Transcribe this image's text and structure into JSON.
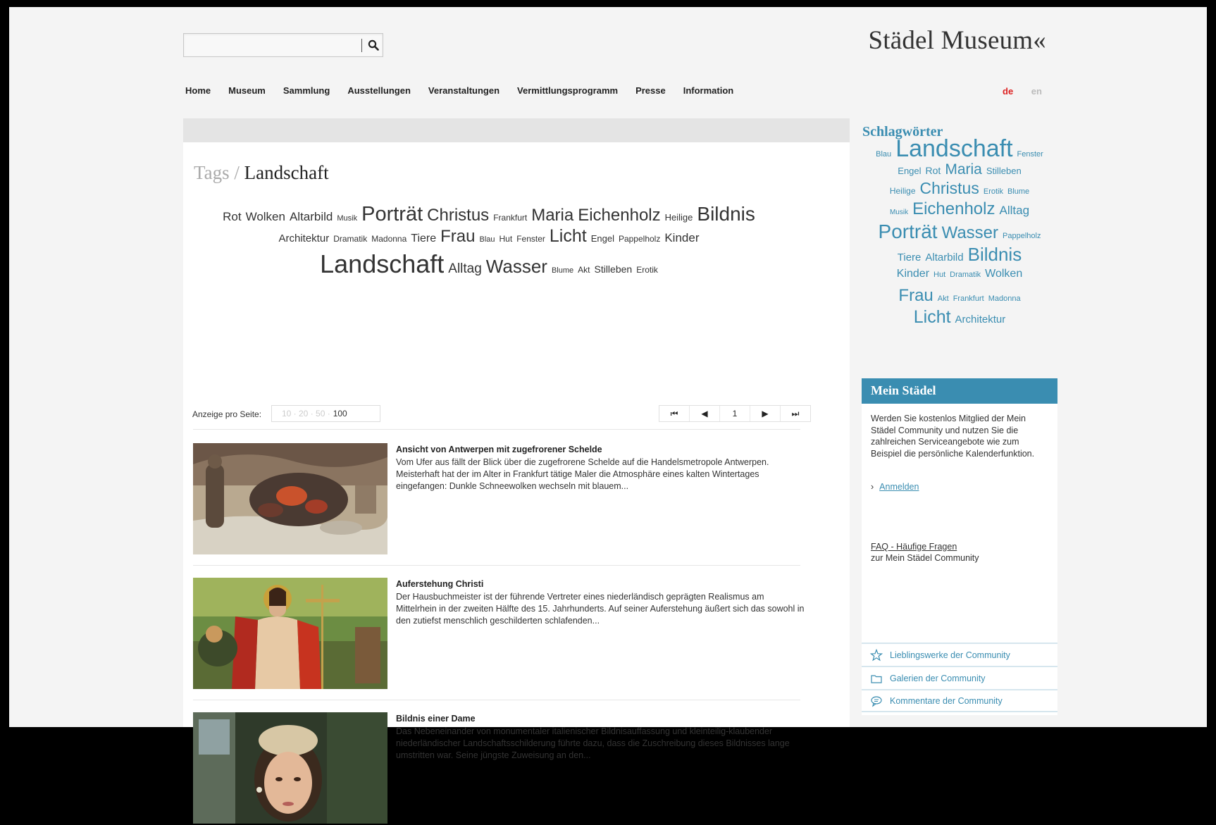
{
  "header": {
    "search_placeholder": "",
    "logo": "Städel Museum«"
  },
  "nav": [
    "Home",
    "Museum",
    "Sammlung",
    "Ausstellungen",
    "Veranstaltungen",
    "Vermittlungsprogramm",
    "Presse",
    "Information"
  ],
  "lang": {
    "de": "de",
    "en": "en"
  },
  "breadcrumb": {
    "tags": "Tags",
    "sep": " / ",
    "current": "Landschaft"
  },
  "tag_cloud": [
    [
      {
        "t": "Rot",
        "s": 17
      },
      {
        "t": "Wolken",
        "s": 17
      },
      {
        "t": "Altarbild",
        "s": 17
      },
      {
        "t": "Musik",
        "s": 11
      },
      {
        "t": "Porträt",
        "s": 29
      },
      {
        "t": "Christus",
        "s": 24
      },
      {
        "t": "Frankfurt",
        "s": 12
      },
      {
        "t": "Maria",
        "s": 24
      },
      {
        "t": "Eichenholz",
        "s": 24
      },
      {
        "t": "Heilige",
        "s": 13
      },
      {
        "t": "Bildnis",
        "s": 28
      }
    ],
    [
      {
        "t": "Architektur",
        "s": 15
      },
      {
        "t": "Dramatik",
        "s": 12
      },
      {
        "t": "Madonna",
        "s": 12
      },
      {
        "t": "Tiere",
        "s": 16
      },
      {
        "t": "Frau",
        "s": 24
      },
      {
        "t": "Blau",
        "s": 11
      },
      {
        "t": "Hut",
        "s": 12
      },
      {
        "t": "Fenster",
        "s": 12
      },
      {
        "t": "Licht",
        "s": 25
      },
      {
        "t": "Engel",
        "s": 13
      },
      {
        "t": "Pappelholz",
        "s": 12
      },
      {
        "t": "Kinder",
        "s": 17
      }
    ],
    [
      {
        "t": "Landschaft",
        "s": 36
      },
      {
        "t": "Alltag",
        "s": 19
      },
      {
        "t": "Wasser",
        "s": 26
      },
      {
        "t": "Blume",
        "s": 11
      },
      {
        "t": "Akt",
        "s": 12
      },
      {
        "t": "Stilleben",
        "s": 14
      },
      {
        "t": "Erotik",
        "s": 12
      }
    ]
  ],
  "pager": {
    "label": "Anzeige pro Seite:",
    "options_dim": "10 · 20 · 50 ·",
    "selected": "100",
    "first": "⏮",
    "prev": "◀",
    "page": "1",
    "next": "▶",
    "last": "⏭"
  },
  "results": [
    {
      "title": "Ansicht von Antwerpen mit zugefrorener Schelde",
      "desc": "Vom Ufer aus fällt der Blick über die zugefrorene Schelde auf die Handelsmetropole Antwerpen. Meisterhaft hat der im Alter in Frankfurt tätige Maler die Atmosphäre eines kalten Wintertages eingefangen: Dunkle Schneewolken wechseln mit blauem..."
    },
    {
      "title": "Auferstehung Christi",
      "desc": "Der Hausbuchmeister ist der führende Vertreter eines niederländisch geprägten Realismus am Mittelrhein in der zweiten Hälfte des 15. Jahrhunderts. Auf seiner Auferstehung äußert sich das sowohl in den zutiefst menschlich geschilderten schlafenden..."
    },
    {
      "title": "Bildnis einer Dame",
      "desc": "Das Nebeneinander von monumentaler italienischer Bildnisauffassung und kleinteilig-klaubender niederländischer Landschaftsschilderung führte dazu, dass die Zuschreibung dieses Bildnisses lange umstritten war. Seine jüngste Zuweisung an den..."
    }
  ],
  "sidebar": {
    "title": "Schlagwörter",
    "cloud": [
      [
        {
          "t": "Blau",
          "s": 11
        },
        {
          "t": "Landschaft",
          "s": 34
        },
        {
          "t": "Fenster",
          "s": 11
        }
      ],
      [
        {
          "t": "Engel",
          "s": 13
        },
        {
          "t": "Rot",
          "s": 14
        },
        {
          "t": "Maria",
          "s": 21
        },
        {
          "t": "Stilleben",
          "s": 13
        }
      ],
      [
        {
          "t": "Heilige",
          "s": 12
        },
        {
          "t": "Christus",
          "s": 23
        },
        {
          "t": "Erotik",
          "s": 11
        },
        {
          "t": "Blume",
          "s": 11
        }
      ],
      [
        {
          "t": "Musik",
          "s": 10
        },
        {
          "t": "Eichenholz",
          "s": 24
        },
        {
          "t": "Alltag",
          "s": 17
        }
      ],
      [
        {
          "t": "Porträt",
          "s": 28
        },
        {
          "t": "Wasser",
          "s": 24
        },
        {
          "t": "Pappelholz",
          "s": 11
        }
      ],
      [
        {
          "t": "Tiere",
          "s": 15
        },
        {
          "t": "Altarbild",
          "s": 15
        },
        {
          "t": "Bildnis",
          "s": 26
        }
      ],
      [
        {
          "t": "Kinder",
          "s": 16
        },
        {
          "t": "Hut",
          "s": 11
        },
        {
          "t": "Dramatik",
          "s": 11
        },
        {
          "t": "Wolken",
          "s": 16
        }
      ],
      [
        {
          "t": "Frau",
          "s": 24
        },
        {
          "t": "Akt",
          "s": 11
        },
        {
          "t": "Frankfurt",
          "s": 11
        },
        {
          "t": "Madonna",
          "s": 11
        }
      ],
      [
        {
          "t": "Licht",
          "s": 25
        },
        {
          "t": "Architektur",
          "s": 15
        }
      ]
    ]
  },
  "mein_staedel": {
    "title": "Mein Städel",
    "text": "Werden Sie kostenlos Mitglied der Mein Städel Community und nutzen Sie die zahlreichen Serviceangebote wie zum Beispiel die persönliche Kalenderfunktion.",
    "login_bullet": "›",
    "login": "Anmelden",
    "faq_link": "FAQ - Häufige Fragen",
    "faq_sub": "zur Mein Städel Community",
    "links": [
      {
        "icon": "star-icon",
        "label": "Lieblingswerke der Community"
      },
      {
        "icon": "folder-icon",
        "label": "Galerien der Community"
      },
      {
        "icon": "comment-icon",
        "label": "Kommentare der Community"
      }
    ]
  },
  "colors": {
    "accent": "#3a8db1",
    "lang_active": "#dd2222",
    "page_bg": "#f4f4f4"
  }
}
